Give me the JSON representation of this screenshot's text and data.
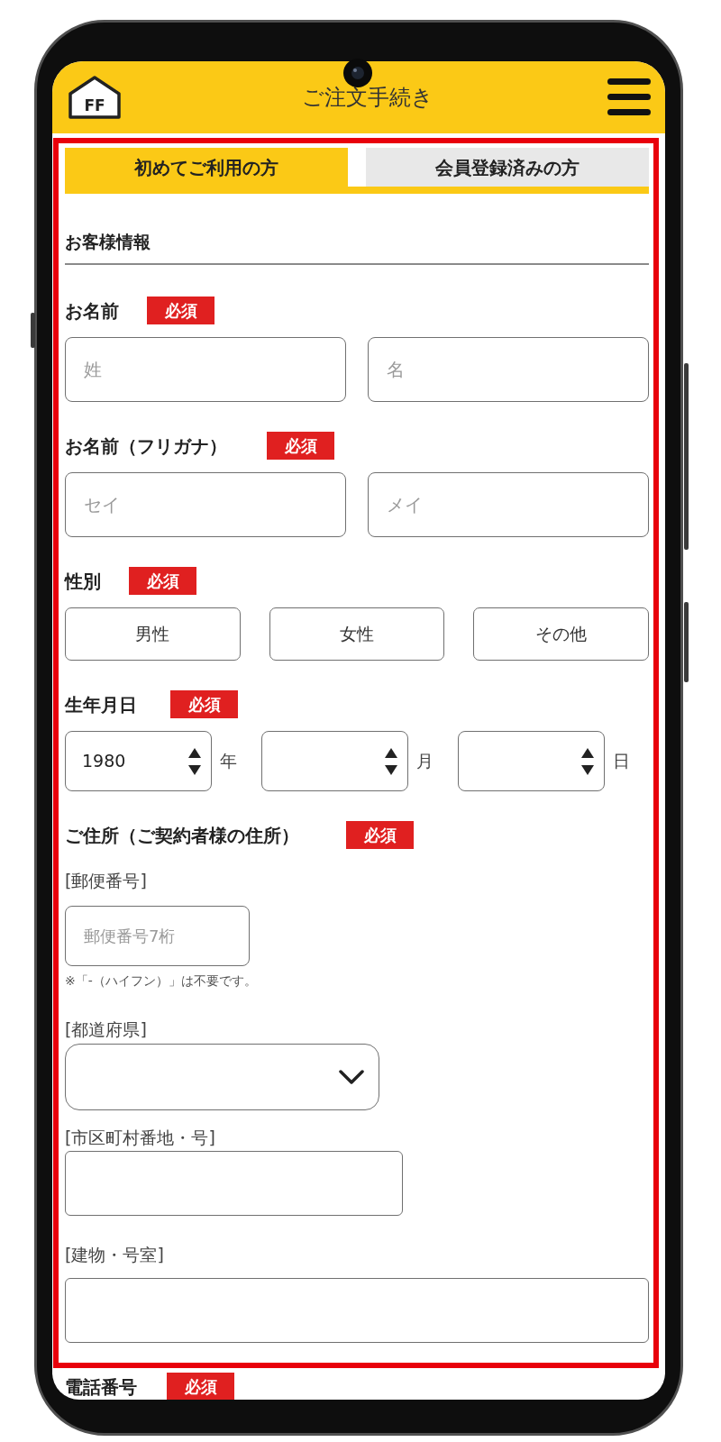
{
  "header": {
    "logo_text": "FF",
    "title": "ご注文手続き"
  },
  "tabs": [
    {
      "label": "初めてご利用の方",
      "selected": true
    },
    {
      "label": "会員登録済みの方",
      "selected": false
    }
  ],
  "section": {
    "title": "お客様情報"
  },
  "groups": [
    {
      "kind": "pair",
      "label": "お名前",
      "badge": "必須",
      "inputs": [
        {
          "placeholder": "姓"
        },
        {
          "placeholder": "名"
        }
      ]
    },
    {
      "kind": "pair",
      "label": "お名前（フリガナ）",
      "badge": "必須",
      "inputs": [
        {
          "placeholder": "セイ"
        },
        {
          "placeholder": "メイ"
        }
      ]
    },
    {
      "kind": "choice",
      "label": "性別",
      "badge": "必須",
      "options": [
        {
          "label": "男性",
          "selected": false
        },
        {
          "label": "女性",
          "selected": false
        },
        {
          "label": "その他",
          "selected": false
        }
      ]
    },
    {
      "kind": "date",
      "label": "生年月日",
      "badge": "必須",
      "selects": [
        {
          "value": "1980",
          "unit": "年"
        },
        {
          "unit": "月"
        },
        {
          "unit": "日"
        }
      ]
    },
    {
      "kind": "address",
      "label": "ご住所（ご契約者様の住所）",
      "badge": "必須",
      "fields": [
        {
          "kind": "text",
          "label": "[郵便番号]",
          "placeholder": "郵便番号7桁",
          "note": "※「-（ハイフン）」は不要です。"
        },
        {
          "kind": "select",
          "label": "[都道府県]"
        },
        {
          "kind": "text",
          "label": "[市区町村番地・号]"
        },
        {
          "kind": "text",
          "label": "[建物・号室]"
        }
      ]
    }
  ],
  "below": [
    {
      "kind": "phone",
      "label": "電話番号",
      "badge": "必須"
    }
  ]
}
